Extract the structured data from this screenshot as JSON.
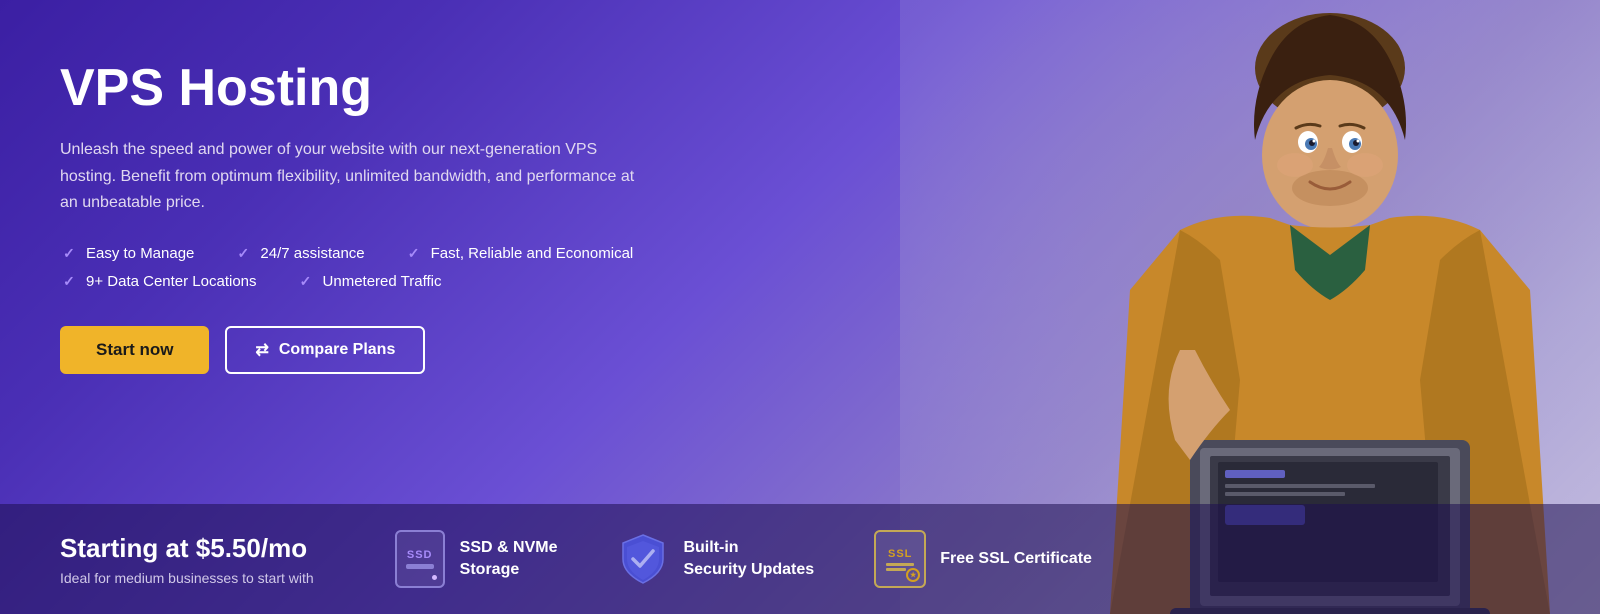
{
  "hero": {
    "title": "VPS Hosting",
    "description": "Unleash the speed and power of your website with our next-generation VPS hosting. Benefit from optimum flexibility, unlimited bandwidth, and performance at an unbeatable price.",
    "features": [
      [
        "Easy to Manage",
        "24/7 assistance",
        "Fast, Reliable and Economical"
      ],
      [
        "9+ Data Center Locations",
        "Unmetered Traffic"
      ]
    ],
    "buttons": {
      "start": "Start now",
      "compare": "Compare Plans"
    }
  },
  "bottom_bar": {
    "price_label": "Starting at $5.50/mo",
    "price_sub": "Ideal for medium businesses to start with",
    "features": [
      {
        "icon": "ssd-icon",
        "label": "SSD & NVMe\nStorage"
      },
      {
        "icon": "shield-icon",
        "label": "Built-in\nSecurity Updates"
      },
      {
        "icon": "ssl-icon",
        "label": "Free SSL Certificate"
      }
    ]
  },
  "colors": {
    "accent_yellow": "#f0b429",
    "purple_dark": "#3b1fa3",
    "purple_mid": "#6a4fd4",
    "text_white": "#ffffff",
    "text_light": "#e0d8f0"
  }
}
